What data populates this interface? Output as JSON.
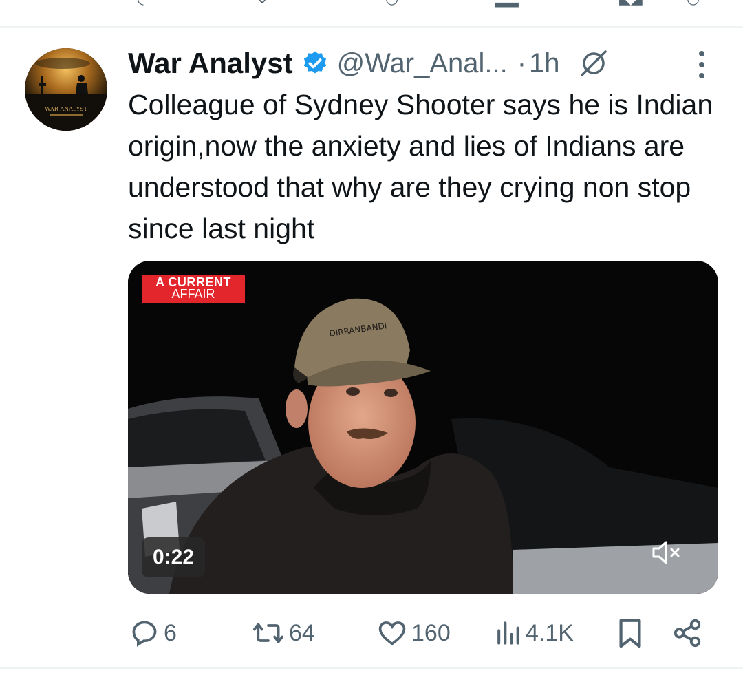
{
  "tweet": {
    "author_name": "War Analyst",
    "handle": "@War_Anal...",
    "separator": "·",
    "time": "1h",
    "avatar_text_line1": "WAR ANALYST",
    "text": "Colleague of Sydney Shooter says he is Indian origin,now the anxiety and lies of Indians are understood that why are they crying non stop since last night",
    "media": {
      "broadcaster_line1": "A CURRENT",
      "broadcaster_line2": "AFFAIR",
      "cap_text": "DIRRANBANDI",
      "duration": "0:22",
      "muted": true
    },
    "actions": {
      "replies": "6",
      "reposts": "64",
      "likes": "160",
      "views": "4.1K"
    }
  },
  "colors": {
    "text_primary": "#0f1419",
    "text_secondary": "#536471",
    "verified_blue": "#1d9bf0",
    "divider": "#eff3f4",
    "badge_red": "#e3262c"
  },
  "icons": [
    "verified-badge-icon",
    "grok-icon",
    "more-icon",
    "reply-icon",
    "repost-icon",
    "like-icon",
    "views-icon",
    "bookmark-icon",
    "share-icon",
    "mute-icon"
  ]
}
